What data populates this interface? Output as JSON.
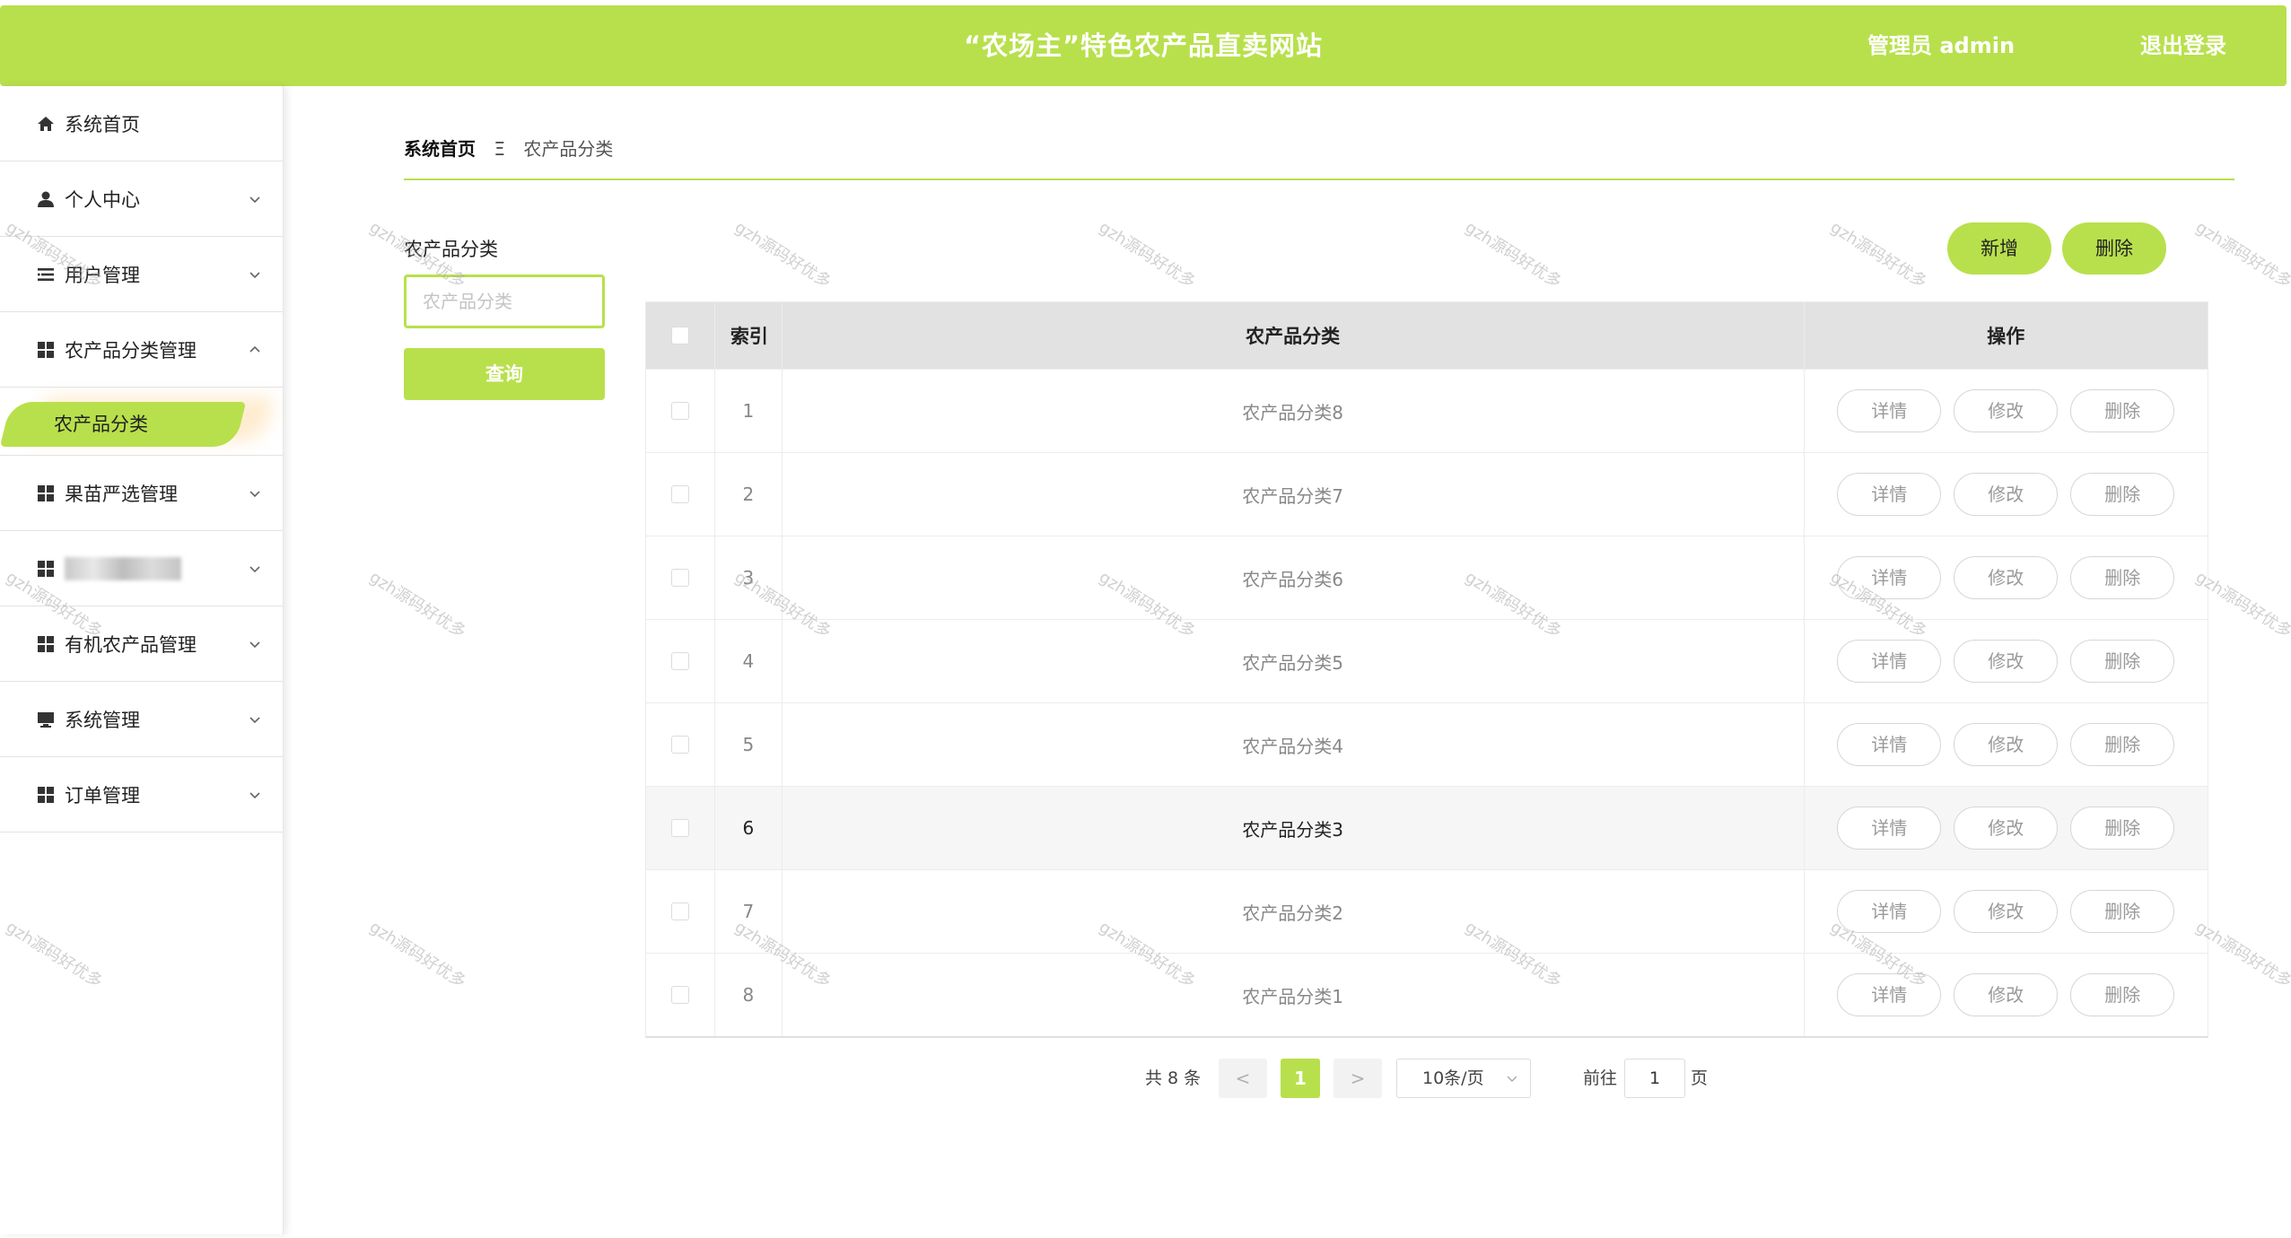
{
  "header": {
    "title": "“农场主”特色农产品直卖网站",
    "admin_label": "管理员 admin",
    "logout_label": "退出登录"
  },
  "sidebar": {
    "items": [
      {
        "label": "系统首页",
        "icon": "home-icon",
        "expandable": false
      },
      {
        "label": "个人中心",
        "icon": "user-icon",
        "expandable": true
      },
      {
        "label": "用户管理",
        "icon": "list-icon",
        "expandable": true
      },
      {
        "label": "农产品分类管理",
        "icon": "grid-icon",
        "expandable": true,
        "expanded": true
      },
      {
        "label": "果苗严选管理",
        "icon": "grid-icon",
        "expandable": true
      },
      {
        "label": "",
        "icon": "grid-icon",
        "expandable": true,
        "blurred": true
      },
      {
        "label": "有机农产品管理",
        "icon": "grid-icon",
        "expandable": true
      },
      {
        "label": "系统管理",
        "icon": "monitor-icon",
        "expandable": true
      },
      {
        "label": "订单管理",
        "icon": "grid-icon",
        "expandable": true
      }
    ],
    "active_sub": "农产品分类"
  },
  "breadcrumb": {
    "home": "系统首页",
    "separator": "Ξ",
    "current": "农产品分类"
  },
  "filter": {
    "label": "农产品分类",
    "placeholder": "农产品分类",
    "value": "",
    "query_label": "查询"
  },
  "actions": {
    "add_label": "新增",
    "delete_label": "删除"
  },
  "table": {
    "columns": [
      "",
      "索引",
      "农产品分类",
      "操作"
    ],
    "rows": [
      {
        "index": "1",
        "name": "农产品分类8"
      },
      {
        "index": "2",
        "name": "农产品分类7"
      },
      {
        "index": "3",
        "name": "农产品分类6"
      },
      {
        "index": "4",
        "name": "农产品分类5"
      },
      {
        "index": "5",
        "name": "农产品分类4"
      },
      {
        "index": "6",
        "name": "农产品分类3"
      },
      {
        "index": "7",
        "name": "农产品分类2"
      },
      {
        "index": "8",
        "name": "农产品分类1"
      }
    ],
    "row_actions": [
      "详情",
      "修改",
      "删除"
    ],
    "hover_row": 6
  },
  "pagination": {
    "total_label": "共 8 条",
    "prev": "<",
    "current": "1",
    "next": ">",
    "page_size": "10条/页",
    "goto_label": "前往",
    "goto_value": "1",
    "page_suffix": "页"
  },
  "watermark": "gzh源码好优多",
  "colors": {
    "accent": "#b8e04c",
    "header_bg": "#b8e04c",
    "table_head_bg": "#e2e2e2"
  }
}
